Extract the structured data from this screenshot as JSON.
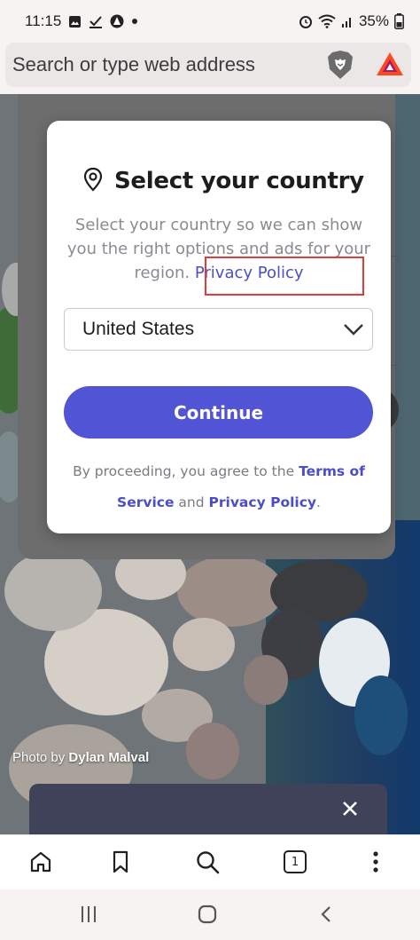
{
  "status_bar": {
    "time": "11:15",
    "battery": "35%",
    "left_icons": [
      "gallery-icon",
      "check-icon",
      "app-icon",
      "dot-icon"
    ],
    "right_icons": [
      "alarm-icon",
      "wifi-icon",
      "signal-icon"
    ]
  },
  "address_bar": {
    "placeholder": "Search or type web address",
    "icons": [
      "brave-shield-icon",
      "bat-rewards-icon"
    ]
  },
  "modal": {
    "title": "Select your country",
    "description": "Select your country so we can show you the right options and ads for your region.",
    "privacy_link": "Privacy Policy",
    "selected_country": "United States",
    "continue_label": "Continue",
    "legal_prefix": "By proceeding, you agree to the",
    "terms_link": "Terms of Service",
    "legal_and": "and",
    "legal_privacy_link": "Privacy Policy",
    "legal_suffix": "."
  },
  "photo_credit": {
    "prefix": "Photo by",
    "author": "Dylan Malval"
  },
  "bottom_toolbar": {
    "tab_count": "1",
    "icons": [
      "home-icon",
      "bookmark-icon",
      "search-icon",
      "tabs-icon",
      "menu-icon"
    ]
  },
  "colors": {
    "accent": "#5154d4",
    "link": "#4b4ec8",
    "highlight": "#e23b3b"
  }
}
